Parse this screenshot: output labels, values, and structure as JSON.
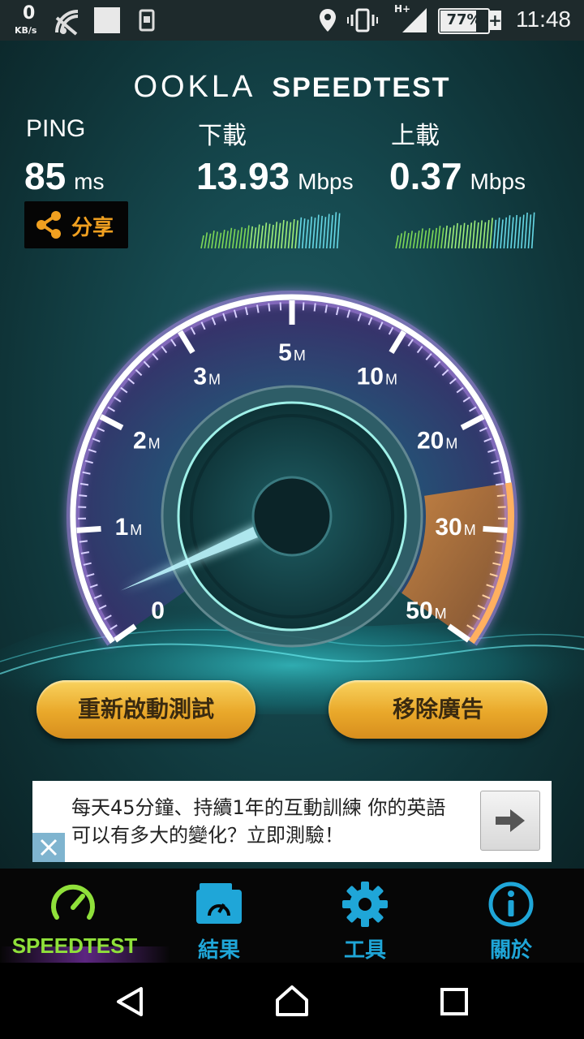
{
  "status_bar": {
    "net_speed_value": "0",
    "net_speed_unit": "KB/s",
    "network_type": "H+",
    "battery_percent": "77%",
    "time": "11:48",
    "icons": [
      "wifi-off-icon",
      "notification-icon",
      "sim-icon",
      "location-icon",
      "vibrate-icon",
      "signal-icon",
      "battery-charging-icon"
    ]
  },
  "header": {
    "brand": "OOKLA",
    "product": "SPEEDTEST"
  },
  "results": {
    "ping": {
      "label": "PING",
      "value": "85",
      "unit": "ms"
    },
    "download": {
      "label": "下載",
      "value": "13.93",
      "unit": "Mbps"
    },
    "upload": {
      "label": "上載",
      "value": "0.37",
      "unit": "Mbps"
    },
    "share_label": "分享"
  },
  "gauge": {
    "tick_labels": [
      {
        "num": "0",
        "unit": ""
      },
      {
        "num": "1",
        "unit": "M"
      },
      {
        "num": "2",
        "unit": "M"
      },
      {
        "num": "3",
        "unit": "M"
      },
      {
        "num": "5",
        "unit": "M"
      },
      {
        "num": "10",
        "unit": "M"
      },
      {
        "num": "20",
        "unit": "M"
      },
      {
        "num": "30",
        "unit": "M"
      },
      {
        "num": "50",
        "unit": "M"
      }
    ],
    "needle_value_mbps": 0.37,
    "colors": {
      "ring": "#ffffff",
      "glow": "#b58cf0",
      "highlight": "#ff9a3c"
    }
  },
  "buttons": {
    "restart": "重新啟動測試",
    "remove_ads": "移除廣告"
  },
  "ad": {
    "text": "每天45分鐘、持續1年的互動訓練 你的英語可以有多大的變化？立即測驗！"
  },
  "tabs": [
    {
      "label": "SPEEDTEST",
      "icon": "speedometer-icon",
      "active": true,
      "color": "#8fe03a"
    },
    {
      "label": "結果",
      "icon": "results-folder-icon",
      "active": false,
      "color": "#1fa6d8"
    },
    {
      "label": "工具",
      "icon": "gear-icon",
      "active": false,
      "color": "#1fa6d8"
    },
    {
      "label": "關於",
      "icon": "info-icon",
      "active": false,
      "color": "#1fa6d8"
    }
  ],
  "nav": [
    "back-icon",
    "home-icon",
    "recents-icon"
  ]
}
